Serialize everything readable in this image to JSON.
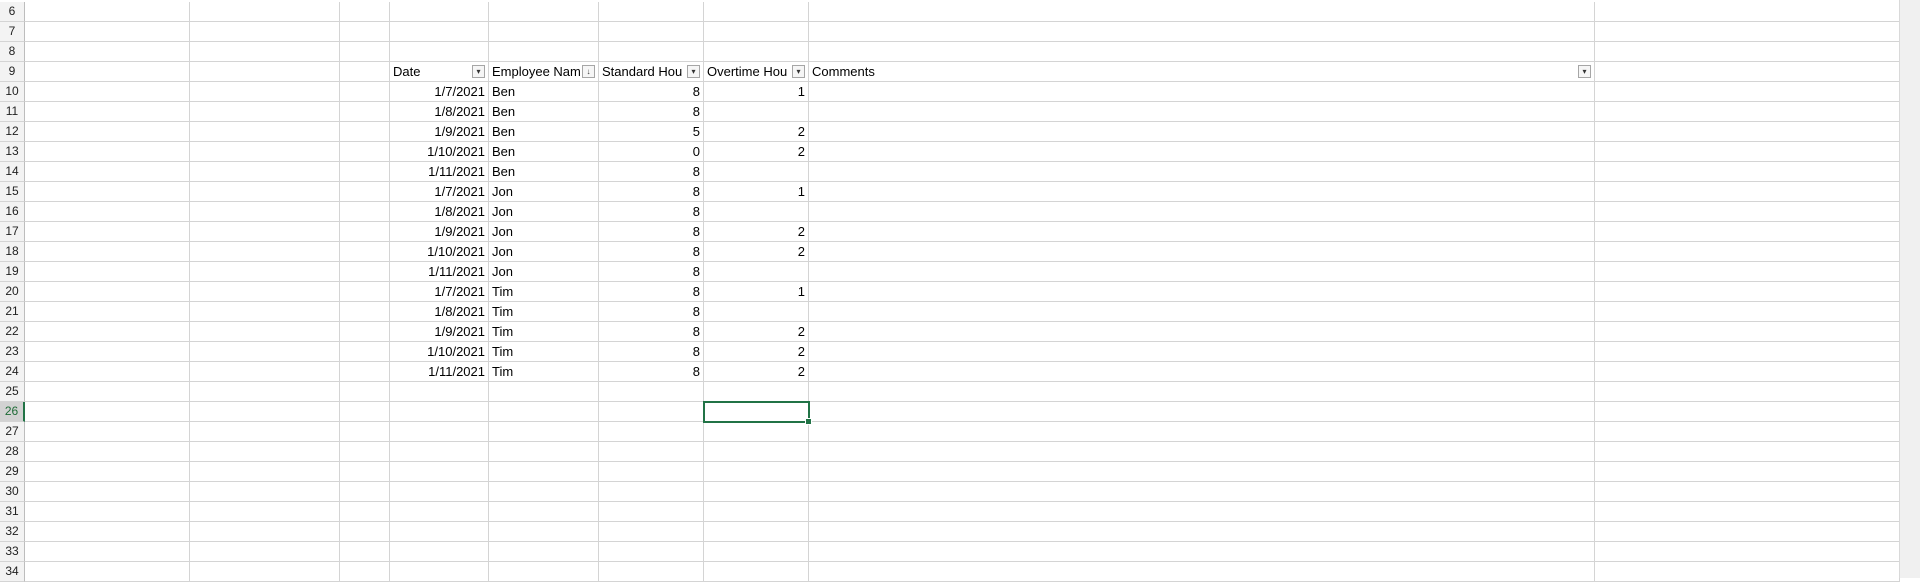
{
  "sheet": {
    "row_numbers": [
      "6",
      "7",
      "8",
      "9",
      "10",
      "11",
      "12",
      "13",
      "14",
      "15",
      "16",
      "17",
      "18",
      "19",
      "20",
      "21",
      "22",
      "23",
      "24",
      "25",
      "26",
      "27",
      "28",
      "29",
      "30",
      "31",
      "32",
      "33",
      "34"
    ],
    "active_row": "26",
    "table": {
      "headers": [
        "Date",
        "Employee Nam",
        "Standard Hou",
        "Overtime Hou",
        "Comments"
      ],
      "filter_icons": [
        "chevron-down-icon",
        "sort-filter-icon",
        "chevron-down-icon",
        "chevron-down-icon",
        "chevron-down-icon"
      ],
      "rows": [
        [
          "1/7/2021",
          "Ben",
          "8",
          "1",
          ""
        ],
        [
          "1/8/2021",
          "Ben",
          "8",
          "",
          ""
        ],
        [
          "1/9/2021",
          "Ben",
          "5",
          "2",
          ""
        ],
        [
          "1/10/2021",
          "Ben",
          "0",
          "2",
          ""
        ],
        [
          "1/11/2021",
          "Ben",
          "8",
          "",
          ""
        ],
        [
          "1/7/2021",
          "Jon",
          "8",
          "1",
          ""
        ],
        [
          "1/8/2021",
          "Jon",
          "8",
          "",
          ""
        ],
        [
          "1/9/2021",
          "Jon",
          "8",
          "2",
          ""
        ],
        [
          "1/10/2021",
          "Jon",
          "8",
          "2",
          ""
        ],
        [
          "1/11/2021",
          "Jon",
          "8",
          "",
          ""
        ],
        [
          "1/7/2021",
          "Tim",
          "8",
          "1",
          ""
        ],
        [
          "1/8/2021",
          "Tim",
          "8",
          "",
          ""
        ],
        [
          "1/9/2021",
          "Tim",
          "8",
          "2",
          ""
        ],
        [
          "1/10/2021",
          "Tim",
          "8",
          "2",
          ""
        ],
        [
          "1/11/2021",
          "Tim",
          "8",
          "2",
          ""
        ]
      ]
    },
    "colors": {
      "grid": "#d4d4d4",
      "selection": "#217346",
      "header_bg": "#f3f3f3"
    }
  }
}
